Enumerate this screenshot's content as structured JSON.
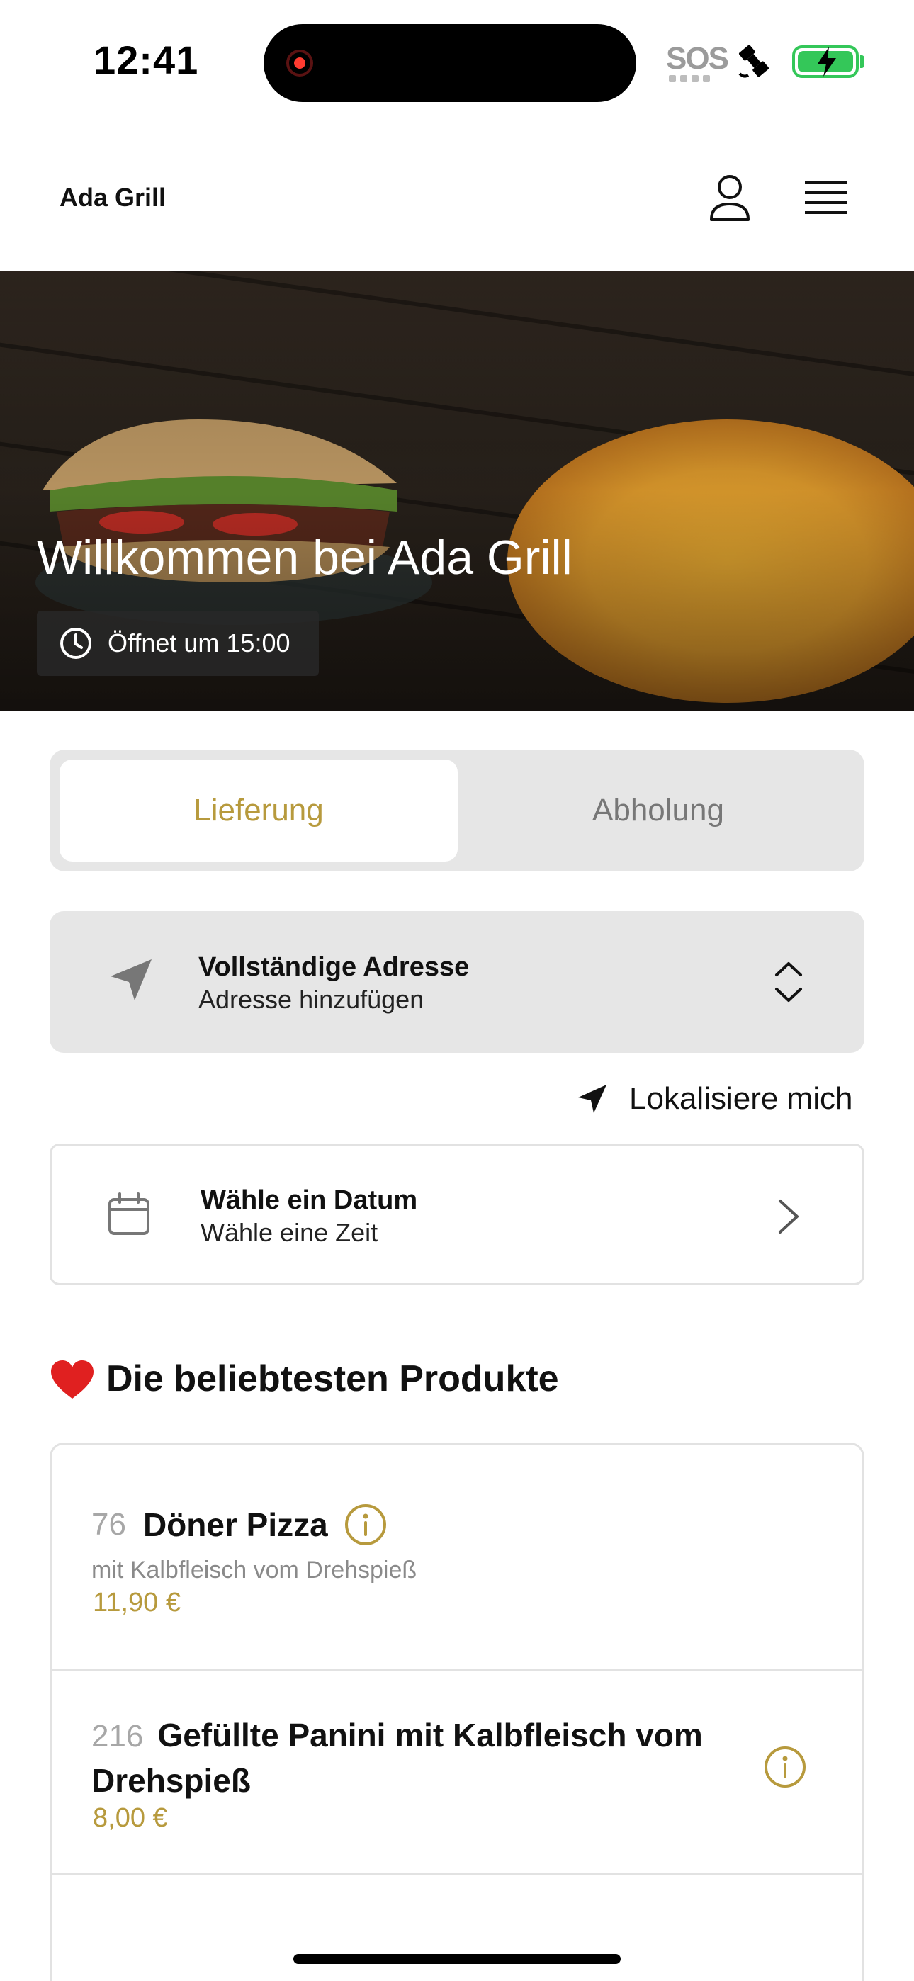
{
  "status_bar": {
    "time": "12:41",
    "sos": "SOS",
    "icons": [
      "recording-dot-icon",
      "satellite-icon",
      "battery-charging-icon"
    ],
    "battery_color": "#34c759"
  },
  "header": {
    "brand": "Ada Grill",
    "icons": [
      "user-icon",
      "hamburger-menu-icon"
    ]
  },
  "hero": {
    "title": "Willkommen bei Ada Grill",
    "hours": "Öffnet um 15:00",
    "hours_icon": "clock-icon"
  },
  "order_mode": {
    "options": [
      "Lieferung",
      "Abholung"
    ],
    "selected": "Lieferung",
    "accent_color": "#b79a3d"
  },
  "address": {
    "title": "Vollständige Adresse",
    "subtitle": "Adresse hinzufügen",
    "icon": "location-arrow-icon"
  },
  "locate_me": {
    "label": "Lokalisiere mich",
    "icon": "navigation-arrow-icon"
  },
  "schedule": {
    "title": "Wähle ein Datum",
    "subtitle": "Wähle eine Zeit",
    "icon": "calendar-icon"
  },
  "popular": {
    "heading": "Die beliebtesten Produkte",
    "heading_icon": "heart-icon",
    "items": [
      {
        "number": "76",
        "name": "Döner Pizza",
        "description": "mit Kalbfleisch vom Drehspieß",
        "price": "11,90 €"
      },
      {
        "number": "216",
        "name": "Gefüllte Panini mit Kalbfleisch vom Drehspieß",
        "price": "8,00 €"
      }
    ]
  }
}
